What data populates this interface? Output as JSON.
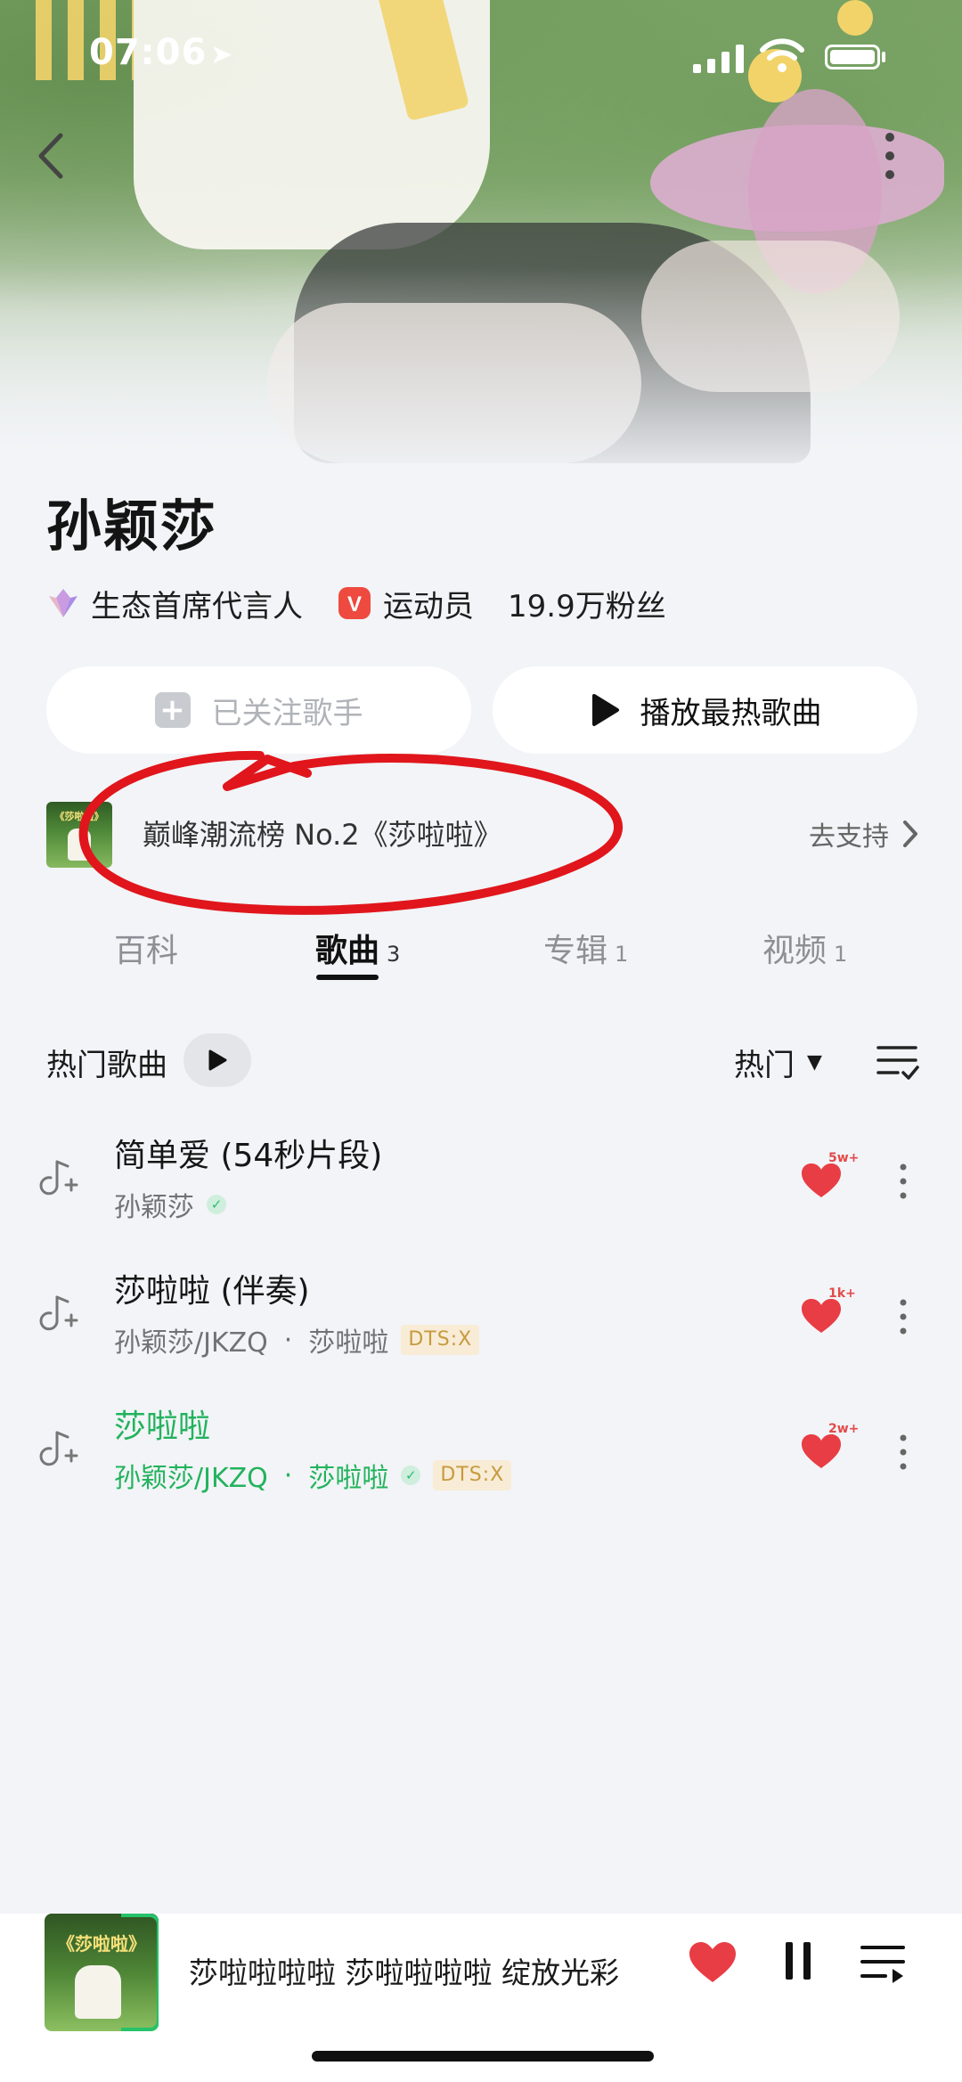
{
  "status": {
    "time": "07:06"
  },
  "artist": {
    "name": "孙颖莎",
    "tags": [
      {
        "label": "生态首席代言人",
        "icon": "diamond-icon"
      },
      {
        "label": "运动员",
        "icon": "v-badge-icon",
        "badge_letter": "V"
      }
    ],
    "fans": "19.9万粉丝"
  },
  "actions": {
    "follow_label": "已关注歌手",
    "play_hot_label": "播放最热歌曲"
  },
  "banner": {
    "text": "巅峰潮流榜 No.2《莎啦啦》",
    "link": "去支持",
    "thumb_title": "《莎啦啦》"
  },
  "tabs": [
    {
      "label": "百科",
      "count": ""
    },
    {
      "label": "歌曲",
      "count": "3"
    },
    {
      "label": "专辑",
      "count": "1"
    },
    {
      "label": "视频",
      "count": "1"
    }
  ],
  "list": {
    "title": "热门歌曲",
    "sort": "热门"
  },
  "songs": [
    {
      "title": "简单爱 (54秒片段)",
      "artist": "孙颖莎",
      "album": "",
      "dts": "",
      "likes": "5w+",
      "playing": false
    },
    {
      "title": "莎啦啦 (伴奏)",
      "artist": "孙颖莎/JKZQ",
      "album": "莎啦啦",
      "dts": "DTS:X",
      "likes": "1k+",
      "playing": false
    },
    {
      "title": "莎啦啦",
      "artist": "孙颖莎/JKZQ",
      "album": "莎啦啦",
      "dts": "DTS:X",
      "likes": "2w+",
      "playing": true
    }
  ],
  "player": {
    "now_playing": "莎啦啦啦啦 莎啦啦啦啦 绽放光彩",
    "cover_title": "《莎啦啦》"
  },
  "colors": {
    "accent_green": "#22b35c",
    "heart_red": "#e83d44",
    "annotation_red": "#e0161c",
    "background": "#f2f4f7"
  }
}
